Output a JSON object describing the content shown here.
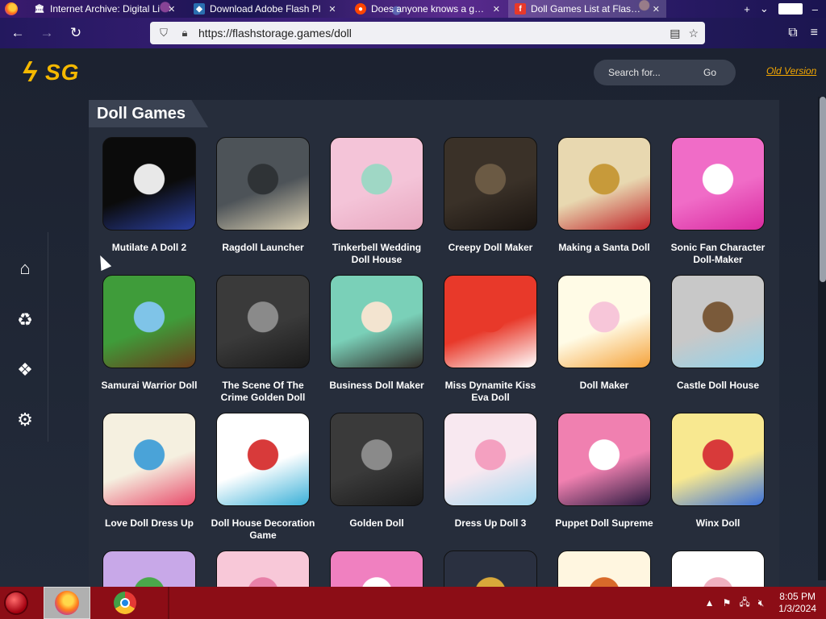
{
  "browser": {
    "tabs": [
      {
        "label": "Internet Archive: Digital Li",
        "favicon": "archive-icon"
      },
      {
        "label": "Download Adobe Flash Pl",
        "favicon": "adobe-icon"
      },
      {
        "label": "Does anyone knows a goo",
        "favicon": "reddit-icon"
      },
      {
        "label": "Doll Games List at FlashSt",
        "favicon": "flash-icon",
        "active": true
      }
    ],
    "url": "https://flashstorage.games/doll"
  },
  "site": {
    "logo_text": "SG",
    "search_placeholder": "Search for...",
    "search_button": "Go",
    "old_version": "Old Version",
    "section_title": "Doll Games"
  },
  "sidebar_icons": [
    "home-icon",
    "recycle-icon",
    "diamond-grid-icon",
    "settings-gear-icon"
  ],
  "games": [
    {
      "title": "Mutilate A Doll 2",
      "colors": [
        "#0b0b0b",
        "#e8e8e8",
        "#2a3fa0"
      ]
    },
    {
      "title": "Ragdoll Launcher",
      "colors": [
        "#4d5358",
        "#2f3336",
        "#d9cfb2"
      ]
    },
    {
      "title": "Tinkerbell Wedding Doll House",
      "colors": [
        "#f4c4d8",
        "#9fd7c5",
        "#e8a8c0"
      ]
    },
    {
      "title": "Creepy Doll Maker",
      "colors": [
        "#3a3128",
        "#6b5a44",
        "#1a1410"
      ]
    },
    {
      "title": "Making a Santa Doll",
      "colors": [
        "#e8d8b0",
        "#c79a3a",
        "#c0232a"
      ]
    },
    {
      "title": "Sonic Fan Character Doll-Maker",
      "colors": [
        "#f06cc7",
        "#ffffff",
        "#d82aa0"
      ]
    },
    {
      "title": "Samurai Warrior Doll",
      "colors": [
        "#3f9c3a",
        "#7fc4e8",
        "#6a3a1a"
      ]
    },
    {
      "title": "The Scene Of The Crime Golden Doll",
      "colors": [
        "#3a3a3a",
        "#8a8a8a",
        "#1a1a1a"
      ]
    },
    {
      "title": "Business Doll Maker",
      "colors": [
        "#7ad0b8",
        "#f3e4d0",
        "#2f2a26"
      ]
    },
    {
      "title": "Miss Dynamite Kiss Eva Doll",
      "colors": [
        "#e8392a",
        "#e8392a",
        "#ffffff"
      ]
    },
    {
      "title": "Doll Maker",
      "colors": [
        "#fffbe6",
        "#f7c6d9",
        "#f5a23a"
      ]
    },
    {
      "title": "Castle Doll House",
      "colors": [
        "#c8c8c8",
        "#7a5a3a",
        "#8fd3ec"
      ]
    },
    {
      "title": "Love Doll Dress Up",
      "colors": [
        "#f5f0e0",
        "#4aa3d8",
        "#e84a6a"
      ]
    },
    {
      "title": "Doll House Decoration Game",
      "colors": [
        "#ffffff",
        "#d83a3a",
        "#3ab0d8"
      ]
    },
    {
      "title": "Golden Doll",
      "colors": [
        "#3a3a3a",
        "#8a8a8a",
        "#1a1a1a"
      ]
    },
    {
      "title": "Dress Up Doll 3",
      "colors": [
        "#f8e8f0",
        "#f4a0c0",
        "#a0d8f0"
      ]
    },
    {
      "title": "Puppet Doll Supreme",
      "colors": [
        "#f080b0",
        "#ffffff",
        "#2a1a40"
      ]
    },
    {
      "title": "Winx Doll",
      "colors": [
        "#f8e890",
        "#d83a3a",
        "#3a70d8"
      ]
    },
    {
      "title": "",
      "colors": [
        "#c8a8e8",
        "#4aa84a",
        "#f0e0d0"
      ]
    },
    {
      "title": "",
      "colors": [
        "#f8c8d8",
        "#e880a8",
        "#ffffff"
      ]
    },
    {
      "title": "",
      "colors": [
        "#f080c0",
        "#ffffff",
        "#3a2a20"
      ]
    },
    {
      "title": "",
      "colors": [
        "#2a3040",
        "#d8a83a",
        "#3a2a20"
      ]
    },
    {
      "title": "",
      "colors": [
        "#fff6e0",
        "#d86a2a",
        "#f0c090"
      ]
    },
    {
      "title": "",
      "colors": [
        "#ffffff",
        "#f0b0c0",
        "#3a2a30"
      ]
    }
  ],
  "taskbar": {
    "time": "8:05 PM",
    "date": "1/3/2024"
  }
}
